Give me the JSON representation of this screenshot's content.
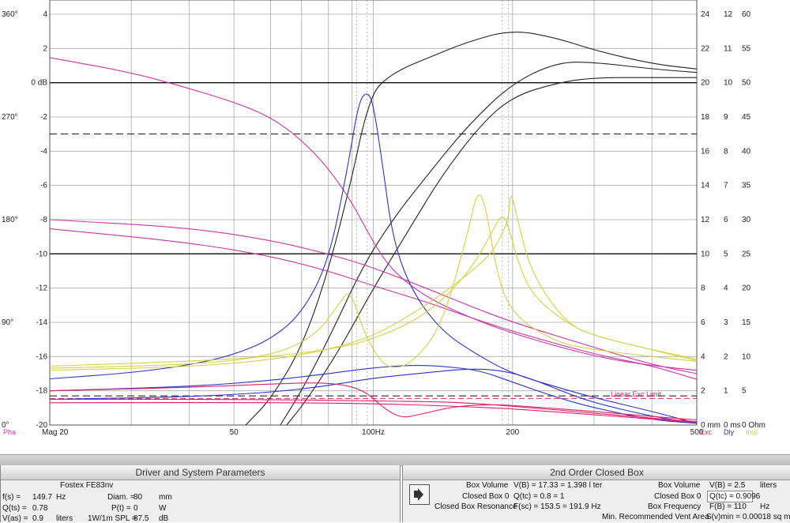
{
  "chart_data": {
    "type": "line",
    "x_axis": {
      "scale": "log",
      "range": [
        20,
        500
      ],
      "tick_labels": [
        {
          "x": 20,
          "label": "Mag 20"
        },
        {
          "x": 50,
          "label": "50"
        },
        {
          "x": 100,
          "label": "100Hz"
        },
        {
          "x": 200,
          "label": "200"
        },
        {
          "x": 500,
          "label": "500"
        }
      ],
      "gridlines": [
        20,
        30,
        40,
        50,
        60,
        70,
        80,
        90,
        100,
        200,
        300,
        400,
        500
      ]
    },
    "axes_left": {
      "phase_labels": [
        {
          "value": 360,
          "label": "360°"
        },
        {
          "value": 270,
          "label": "270°"
        },
        {
          "value": 180,
          "label": "180°"
        },
        {
          "value": 90,
          "label": "90°"
        },
        {
          "value": 0,
          "label": "0°"
        }
      ],
      "phase_range": [
        0,
        360
      ],
      "mag_labels": [
        {
          "value": 4,
          "label": "4"
        },
        {
          "value": 2,
          "label": "2"
        },
        {
          "value": 0,
          "label": "0 dB"
        },
        {
          "value": -2,
          "label": "-2"
        },
        {
          "value": -4,
          "label": "-4"
        },
        {
          "value": -6,
          "label": "-6"
        },
        {
          "value": -8,
          "label": "-8"
        },
        {
          "value": -10,
          "label": "-10"
        },
        {
          "value": -12,
          "label": "-12"
        },
        {
          "value": -14,
          "label": "-14"
        },
        {
          "value": -16,
          "label": "-16"
        },
        {
          "value": -18,
          "label": "-18"
        },
        {
          "value": -20,
          "label": "-20"
        }
      ],
      "mag_range": [
        -20,
        4
      ]
    },
    "axes_right": {
      "exc_labels": [
        "0 mm",
        "2",
        "4",
        "6",
        "8",
        "10",
        "12",
        "14",
        "16",
        "18",
        "20",
        "22",
        "24"
      ],
      "dly_labels": [
        "0 ms",
        "1",
        "2",
        "3",
        "4",
        "5",
        "6",
        "7",
        "8",
        "9",
        "10",
        "11",
        "12"
      ],
      "imp_labels": [
        "0 Ohm",
        "5",
        "10",
        "15",
        "20",
        "25",
        "30",
        "35",
        "40",
        "45",
        "50",
        "55",
        "60"
      ]
    },
    "footer_legend": {
      "pha": "Pha",
      "exc": "Exc",
      "dly": "Dly",
      "imp": "Imp"
    },
    "reference_lines": {
      "solid_db": [
        0,
        -10
      ],
      "dashed_db": [
        -3,
        -18.3
      ],
      "phase_solid_deg": 0
    },
    "annotation": "Linear Exc Limit",
    "colors": {
      "magnitude": "#222222",
      "phase": "#cc33aa",
      "delay": "#2a33cc",
      "impedance": "#d8d040",
      "excursion": "#e0206a",
      "grid": "#a8a8a8"
    },
    "series": [
      {
        "group": "magnitude",
        "color": "#222222",
        "points": [
          [
            53,
            -20
          ],
          [
            60,
            -18.5
          ],
          [
            70,
            -15.5
          ],
          [
            80,
            -11
          ],
          [
            90,
            -5.5
          ],
          [
            95,
            -2.5
          ],
          [
            100,
            -0.6
          ],
          [
            105,
            0.1
          ],
          [
            115,
            0.8
          ],
          [
            130,
            1.4
          ],
          [
            160,
            2.4
          ],
          [
            200,
            3.1
          ],
          [
            250,
            2.6
          ],
          [
            300,
            1.9
          ],
          [
            400,
            1.1
          ],
          [
            500,
            0.8
          ]
        ]
      },
      {
        "group": "magnitude",
        "color": "#222222",
        "points": [
          [
            63,
            -20
          ],
          [
            70,
            -18
          ],
          [
            80,
            -15
          ],
          [
            95,
            -10.7
          ],
          [
            110,
            -8
          ],
          [
            130,
            -5.5
          ],
          [
            160,
            -2.5
          ],
          [
            200,
            0
          ],
          [
            250,
            1.2
          ],
          [
            300,
            1.2
          ],
          [
            400,
            0.8
          ],
          [
            500,
            0.6
          ]
        ]
      },
      {
        "group": "magnitude",
        "color": "#222222",
        "points": [
          [
            65,
            -20
          ],
          [
            72,
            -18.5
          ],
          [
            85,
            -15.5
          ],
          [
            100,
            -12
          ],
          [
            120,
            -8.5
          ],
          [
            140,
            -5.5
          ],
          [
            170,
            -2.5
          ],
          [
            200,
            -0.8
          ],
          [
            250,
            0
          ],
          [
            300,
            0.3
          ],
          [
            400,
            0.3
          ],
          [
            500,
            0.3
          ]
        ]
      },
      {
        "group": "phase",
        "color": "#cc33aa",
        "points": [
          [
            20,
            322
          ],
          [
            30,
            309
          ],
          [
            40,
            295
          ],
          [
            50,
            283
          ],
          [
            60,
            270
          ],
          [
            70,
            250
          ],
          [
            80,
            225
          ],
          [
            90,
            195
          ],
          [
            100,
            160
          ],
          [
            110,
            135
          ],
          [
            130,
            112
          ],
          [
            160,
            95
          ],
          [
            200,
            80
          ],
          [
            300,
            60
          ],
          [
            400,
            52
          ],
          [
            500,
            48
          ]
        ]
      },
      {
        "group": "phase",
        "color": "#cc33aa",
        "points": [
          [
            20,
            180
          ],
          [
            40,
            173
          ],
          [
            60,
            162
          ],
          [
            80,
            150
          ],
          [
            100,
            138
          ],
          [
            130,
            120
          ],
          [
            160,
            105
          ],
          [
            200,
            90
          ],
          [
            300,
            68
          ],
          [
            400,
            53
          ],
          [
            500,
            45
          ]
        ]
      },
      {
        "group": "phase",
        "color": "#cc33aa",
        "points": [
          [
            20,
            172
          ],
          [
            40,
            160
          ],
          [
            60,
            148
          ],
          [
            80,
            135
          ],
          [
            100,
            122
          ],
          [
            130,
            108
          ],
          [
            160,
            95
          ],
          [
            200,
            82
          ],
          [
            300,
            62
          ],
          [
            400,
            52
          ],
          [
            500,
            40
          ]
        ]
      },
      {
        "group": "delay",
        "color": "#2a33cc",
        "points": [
          [
            20,
            2.7
          ],
          [
            30,
            3.05
          ],
          [
            40,
            3.5
          ],
          [
            50,
            4.1
          ],
          [
            60,
            5.0
          ],
          [
            70,
            6.5
          ],
          [
            80,
            9.5
          ],
          [
            88,
            15
          ],
          [
            93,
            18.9
          ],
          [
            97,
            19.5
          ],
          [
            100,
            18.8
          ],
          [
            105,
            15
          ],
          [
            110,
            11
          ],
          [
            120,
            8
          ],
          [
            140,
            5.5
          ],
          [
            170,
            4
          ],
          [
            200,
            3
          ],
          [
            250,
            2.2
          ],
          [
            300,
            1.6
          ],
          [
            400,
            0.8
          ],
          [
            500,
            0.1
          ]
        ]
      },
      {
        "group": "delay",
        "color": "#2a33cc",
        "points": [
          [
            20,
            2.0
          ],
          [
            40,
            2.25
          ],
          [
            60,
            2.6
          ],
          [
            80,
            3.0
          ],
          [
            100,
            3.35
          ],
          [
            120,
            3.5
          ],
          [
            140,
            3.45
          ],
          [
            170,
            3.2
          ],
          [
            200,
            2.5
          ],
          [
            250,
            1.6
          ],
          [
            300,
            1.0
          ],
          [
            400,
            0.3
          ],
          [
            500,
            0.1
          ]
        ]
      },
      {
        "group": "delay",
        "color": "#2a33cc",
        "points": [
          [
            20,
            1.5
          ],
          [
            40,
            1.65
          ],
          [
            60,
            1.9
          ],
          [
            80,
            2.3
          ],
          [
            100,
            2.75
          ],
          [
            130,
            3.05
          ],
          [
            160,
            3.3
          ],
          [
            190,
            3.2
          ],
          [
            220,
            2.7
          ],
          [
            260,
            1.9
          ],
          [
            300,
            1.3
          ],
          [
            400,
            0.5
          ],
          [
            500,
            0.1
          ]
        ]
      },
      {
        "group": "impedance",
        "color": "#d8d040",
        "points": [
          [
            20,
            8.3
          ],
          [
            40,
            8.8
          ],
          [
            60,
            10
          ],
          [
            75,
            13
          ],
          [
            85,
            18
          ],
          [
            88,
            19.5
          ],
          [
            91,
            18
          ],
          [
            95,
            14
          ],
          [
            100,
            11
          ],
          [
            105,
            9
          ],
          [
            110,
            8.3
          ],
          [
            120,
            8.8
          ],
          [
            140,
            14
          ],
          [
            160,
            28
          ],
          [
            168,
            34.5
          ],
          [
            175,
            32
          ],
          [
            185,
            22
          ],
          [
            200,
            16
          ],
          [
            250,
            12
          ],
          [
            300,
            11
          ],
          [
            400,
            10
          ],
          [
            500,
            9.3
          ]
        ]
      },
      {
        "group": "impedance",
        "color": "#d8d040",
        "points": [
          [
            20,
            8.6
          ],
          [
            40,
            9.3
          ],
          [
            60,
            10
          ],
          [
            80,
            11
          ],
          [
            100,
            12.5
          ],
          [
            130,
            16
          ],
          [
            160,
            22
          ],
          [
            180,
            28
          ],
          [
            190,
            31
          ],
          [
            196,
            29
          ],
          [
            205,
            24
          ],
          [
            220,
            19
          ],
          [
            260,
            15
          ],
          [
            300,
            13
          ],
          [
            400,
            11
          ],
          [
            500,
            9.6
          ]
        ]
      },
      {
        "group": "impedance",
        "color": "#d8d040",
        "points": [
          [
            20,
            8
          ],
          [
            40,
            8.5
          ],
          [
            60,
            9.5
          ],
          [
            80,
            11
          ],
          [
            100,
            13
          ],
          [
            120,
            16
          ],
          [
            140,
            19
          ],
          [
            160,
            22
          ],
          [
            180,
            25
          ],
          [
            190,
            28
          ],
          [
            196,
            30
          ],
          [
            198,
            34.5
          ],
          [
            205,
            30
          ],
          [
            220,
            22
          ],
          [
            260,
            15
          ],
          [
            300,
            13
          ],
          [
            400,
            11
          ],
          [
            500,
            9.4
          ]
        ]
      },
      {
        "group": "excursion",
        "color": "#e0206a",
        "points": [
          [
            20,
            2.0
          ],
          [
            40,
            2.2
          ],
          [
            60,
            2.4
          ],
          [
            80,
            2.5
          ],
          [
            95,
            2.1
          ],
          [
            105,
            1.0
          ],
          [
            115,
            0.4
          ],
          [
            125,
            0.6
          ],
          [
            150,
            1.1
          ],
          [
            180,
            1.2
          ],
          [
            200,
            1.15
          ],
          [
            300,
            0.8
          ],
          [
            400,
            0.5
          ],
          [
            500,
            0.3
          ]
        ]
      },
      {
        "group": "excursion",
        "color": "#e0206a",
        "points": [
          [
            20,
            1.5
          ],
          [
            60,
            1.5
          ],
          [
            100,
            1.4
          ],
          [
            150,
            1.35
          ],
          [
            200,
            1.1
          ],
          [
            300,
            0.7
          ],
          [
            400,
            0.4
          ],
          [
            500,
            0.2
          ]
        ]
      },
      {
        "group": "excursion",
        "color": "#e0206a",
        "points": [
          [
            20,
            1.3
          ],
          [
            60,
            1.32
          ],
          [
            100,
            1.25
          ],
          [
            150,
            1.1
          ],
          [
            200,
            0.95
          ],
          [
            300,
            0.6
          ],
          [
            400,
            0.35
          ],
          [
            500,
            0.15
          ]
        ]
      }
    ]
  },
  "panel_driver": {
    "title": "Driver and System Parameters",
    "driver_name": "Fostex FE83nv",
    "fs_label": "f(s) =",
    "fs_value": "149.7",
    "fs_unit": "Hz",
    "diam_label": "Diam. =",
    "diam_value": "80",
    "diam_unit": "mm",
    "qts_label": "Q(ts) =",
    "qts_value": "0.78",
    "pt_label": "P(t) =",
    "pt_value": "0",
    "pt_unit": "W",
    "vas_label": "V(as) =",
    "vas_value": "0.9",
    "vas_unit": "liters",
    "spl_label": "1W/1m SPL =",
    "spl_value": "87.5",
    "spl_unit": "dB"
  },
  "panel_box": {
    "title": "2nd Order Closed Box",
    "box_volume_label": "Box Volume",
    "vb_left": "V(B) = 17.33  = 1.398 l ter",
    "closed_box_label": "Closed Box 0",
    "qtc_left": "Q(tc) = 0.8     =  1",
    "resonance_label": "Closed Box Resonance",
    "fsc_left": "F(sc) = 153.5  = 191.9 Hz",
    "box_volume_label2": "Box Volume",
    "vb_right": "V(B) = 2.5",
    "vb_right_unit": "liters",
    "closed_box_label2": "Closed Box 0",
    "qtc_right": "Q(tc) = 0.9096",
    "box_freq_label": "Box Frequency",
    "fb_right": "F(B) = 110",
    "fb_unit": "Hz",
    "vent_label": "Min. Recommended Vent Area",
    "vent_value": "S(v)min = 0.00018 sq m"
  }
}
